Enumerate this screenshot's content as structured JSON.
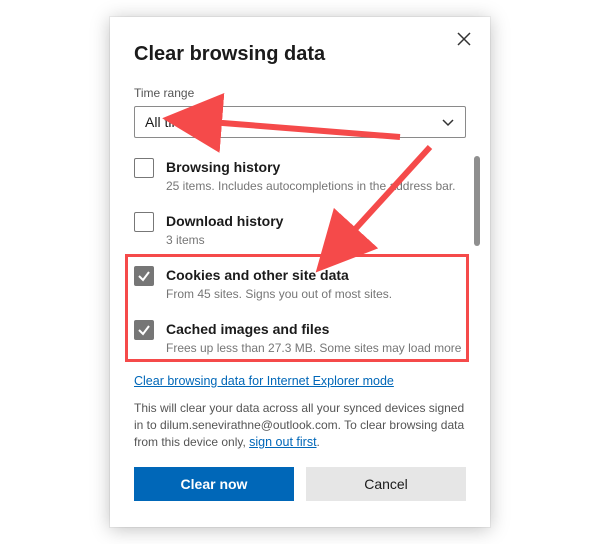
{
  "dialog": {
    "title": "Clear browsing data",
    "time_range_label": "Time range",
    "time_range_value": "All time",
    "items": [
      {
        "checked": false,
        "title": "Browsing history",
        "sub": "25 items. Includes autocompletions in the address bar."
      },
      {
        "checked": false,
        "title": "Download history",
        "sub": "3 items"
      },
      {
        "checked": true,
        "title": "Cookies and other site data",
        "sub": "From 45 sites. Signs you out of most sites."
      },
      {
        "checked": true,
        "title": "Cached images and files",
        "sub": "Frees up less than 27.3 MB. Some sites may load more"
      }
    ],
    "ie_link": "Clear browsing data for Internet Explorer mode",
    "footnote_a": "This will clear your data across all your synced devices signed in to dilum.senevirathne@outlook.com. To clear browsing data from this device only, ",
    "footnote_link": "sign out first",
    "footnote_b": ".",
    "primary": "Clear now",
    "secondary": "Cancel"
  },
  "annotation": {
    "highlight_items": [
      2,
      3
    ],
    "color": "#f54a4a"
  }
}
